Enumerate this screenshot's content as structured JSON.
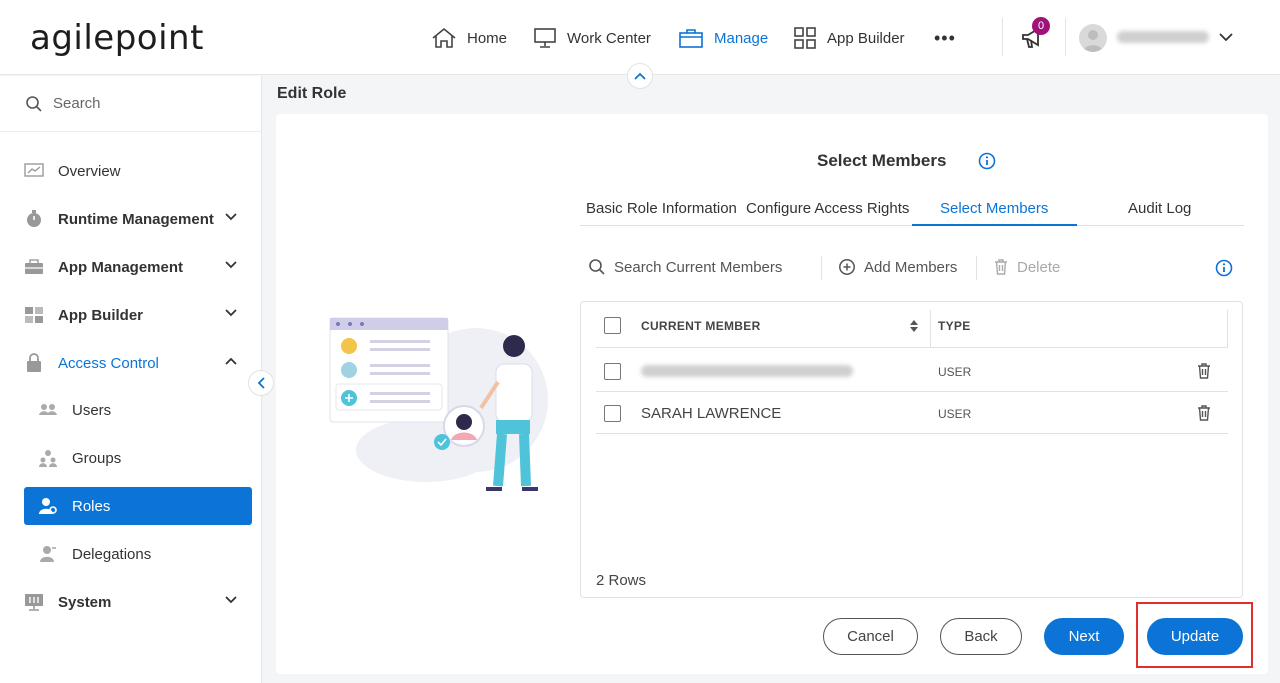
{
  "header": {
    "logo": "agilepoint",
    "nav": [
      {
        "label": "Home",
        "icon": "home-icon"
      },
      {
        "label": "Work Center",
        "icon": "monitor-icon"
      },
      {
        "label": "Manage",
        "icon": "briefcase-icon"
      },
      {
        "label": "App Builder",
        "icon": "grid-icon"
      }
    ],
    "more": "•••",
    "notifications_count": "0"
  },
  "sidebar": {
    "search_placeholder": "Search",
    "items": [
      {
        "label": "Overview",
        "icon": "chart-icon"
      },
      {
        "label": "Runtime Management",
        "icon": "stopwatch-icon"
      },
      {
        "label": "App Management",
        "icon": "toolbox-icon"
      },
      {
        "label": "App Builder",
        "icon": "blocks-icon"
      },
      {
        "label": "Access Control",
        "icon": "lock-icon"
      },
      {
        "label": "Users",
        "icon": "users-icon"
      },
      {
        "label": "Groups",
        "icon": "groups-icon"
      },
      {
        "label": "Roles",
        "icon": "roles-icon"
      },
      {
        "label": "Delegations",
        "icon": "delegation-icon"
      },
      {
        "label": "System",
        "icon": "system-icon"
      }
    ]
  },
  "page": {
    "title": "Edit Role",
    "section_title": "Select Members",
    "tabs": [
      "Basic Role Information",
      "Configure Access Rights",
      "Select Members",
      "Audit Log"
    ],
    "active_tab": "Select Members",
    "toolbar": {
      "search_placeholder": "Search Current Members",
      "add": "Add Members",
      "delete": "Delete"
    },
    "grid": {
      "columns": [
        "CURRENT MEMBER",
        "TYPE"
      ],
      "rows": [
        {
          "member": "",
          "type": "USER"
        },
        {
          "member": "SARAH LAWRENCE",
          "type": "USER"
        }
      ],
      "rows_count": "2 Rows"
    },
    "buttons": {
      "cancel": "Cancel",
      "back": "Back",
      "next": "Next",
      "update": "Update"
    }
  },
  "colors": {
    "accent": "#0b74d6",
    "badge": "#a0127a",
    "highlight": "#e0302d"
  }
}
